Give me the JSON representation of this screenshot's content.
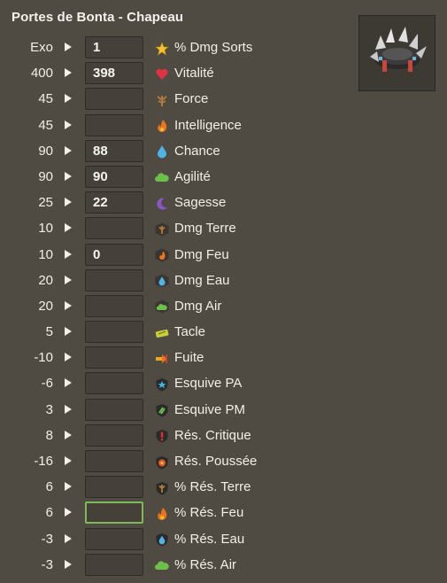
{
  "header": {
    "title": "Portes de Bonta - Chapeau"
  },
  "colors": {
    "background": "#4f4a42",
    "input_bg": "#45413a",
    "focus_border": "#7fba5a"
  },
  "rows": [
    {
      "base": "Exo",
      "value": "1",
      "label": "% Dmg Sorts",
      "icon": "star-icon"
    },
    {
      "base": "400",
      "value": "398",
      "label": "Vitalité",
      "icon": "heart-icon"
    },
    {
      "base": "45",
      "value": "",
      "label": "Force",
      "icon": "earth-icon"
    },
    {
      "base": "45",
      "value": "",
      "label": "Intelligence",
      "icon": "fire-icon"
    },
    {
      "base": "90",
      "value": "88",
      "label": "Chance",
      "icon": "water-drop-icon"
    },
    {
      "base": "90",
      "value": "90",
      "label": "Agilité",
      "icon": "air-cloud-icon"
    },
    {
      "base": "25",
      "value": "22",
      "label": "Sagesse",
      "icon": "moon-icon"
    },
    {
      "base": "10",
      "value": "",
      "label": "Dmg Terre",
      "icon": "earth-damage-icon"
    },
    {
      "base": "10",
      "value": "0",
      "label": "Dmg Feu",
      "icon": "fire-damage-icon"
    },
    {
      "base": "20",
      "value": "",
      "label": "Dmg Eau",
      "icon": "water-damage-icon"
    },
    {
      "base": "20",
      "value": "",
      "label": "Dmg Air",
      "icon": "air-damage-icon"
    },
    {
      "base": "5",
      "value": "",
      "label": "Tacle",
      "icon": "tackle-icon"
    },
    {
      "base": "-10",
      "value": "",
      "label": "Fuite",
      "icon": "flee-icon"
    },
    {
      "base": "-6",
      "value": "",
      "label": "Esquive PA",
      "icon": "ap-dodge-icon"
    },
    {
      "base": "3",
      "value": "",
      "label": "Esquive PM",
      "icon": "mp-dodge-icon"
    },
    {
      "base": "8",
      "value": "",
      "label": "Rés. Critique",
      "icon": "critical-resistance-icon"
    },
    {
      "base": "-16",
      "value": "",
      "label": "Rés. Poussée",
      "icon": "pushback-resistance-icon"
    },
    {
      "base": "6",
      "value": "",
      "label": "% Rés. Terre",
      "icon": "earth-resistance-icon"
    },
    {
      "base": "6",
      "value": "",
      "label": "% Rés. Feu",
      "icon": "fire-resistance-icon",
      "focused": true
    },
    {
      "base": "-3",
      "value": "",
      "label": "% Rés. Eau",
      "icon": "water-resistance-icon"
    },
    {
      "base": "-3",
      "value": "",
      "label": "% Rés. Air",
      "icon": "air-resistance-icon"
    }
  ]
}
